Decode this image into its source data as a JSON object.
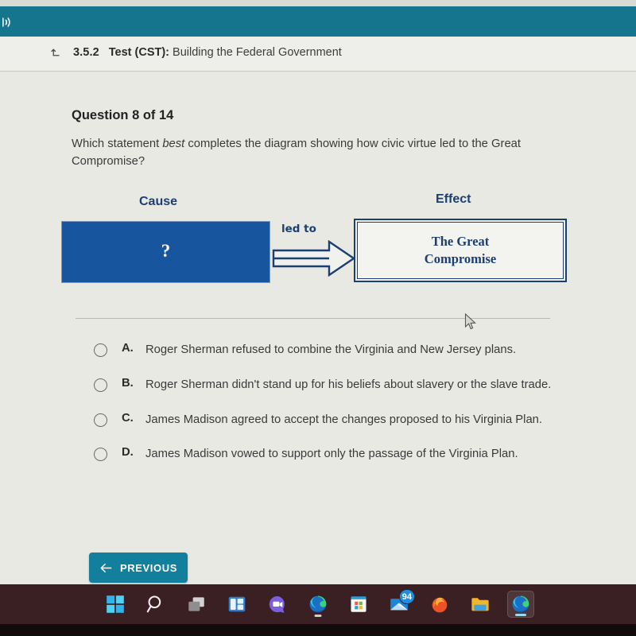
{
  "colors": {
    "teal_bar": "#15758C",
    "page_bg": "#E9E9E4",
    "cause_box_blue": "#17559F",
    "navy_text": "#1C3F72",
    "button_teal": "#12809C",
    "taskbar": "#3B2023",
    "badge_blue": "#1F8EE0"
  },
  "app_bar": {
    "sound_icon": "speaker-volume-icon"
  },
  "breadcrumb": {
    "up_icon": "return-up-arrow-icon",
    "number": "3.5.2",
    "title_bold": "Test (CST):",
    "title_rest": "Building the Federal Government"
  },
  "question": {
    "heading": "Question 8 of 14",
    "prompt_part1": "Which statement ",
    "prompt_emphasis": "best",
    "prompt_part2": " completes the diagram showing how civic virtue led to the Great Compromise?"
  },
  "diagram": {
    "cause_label": "Cause",
    "effect_label": "Effect",
    "cause_box_text": "?",
    "arrow_label": "led to",
    "effect_box_line1": "The Great",
    "effect_box_line2": "Compromise",
    "arrow_icon": "block-arrow-right-icon"
  },
  "choices": [
    {
      "letter": "A.",
      "text": "Roger Sherman refused to combine the Virginia and New Jersey plans.",
      "radio_icon": "radio-unselected-icon",
      "selected": false
    },
    {
      "letter": "B.",
      "text": "Roger Sherman didn't stand up for his beliefs about slavery or the slave trade.",
      "radio_icon": "radio-unselected-icon",
      "selected": false
    },
    {
      "letter": "C.",
      "text": "James Madison agreed to accept the changes proposed to his Virginia Plan.",
      "radio_icon": "radio-unselected-icon",
      "selected": false
    },
    {
      "letter": "D.",
      "text": "James Madison vowed to support only the passage of the Virginia Plan.",
      "radio_icon": "radio-unselected-icon",
      "selected": false
    }
  ],
  "footer": {
    "previous_label": "PREVIOUS",
    "previous_icon": "arrow-left-icon"
  },
  "taskbar": {
    "items": [
      {
        "icon": "windows-start-icon",
        "name": "start"
      },
      {
        "icon": "search-icon",
        "name": "search"
      },
      {
        "icon": "task-view-icon",
        "name": "task-view"
      },
      {
        "icon": "widgets-icon",
        "name": "widgets"
      },
      {
        "icon": "teams-chat-icon",
        "name": "chat"
      },
      {
        "icon": "edge-browser-icon",
        "name": "edge"
      },
      {
        "icon": "microsoft-store-icon",
        "name": "store"
      },
      {
        "icon": "mail-icon",
        "name": "mail",
        "badge": "94"
      },
      {
        "icon": "firefox-icon",
        "name": "firefox"
      },
      {
        "icon": "file-explorer-icon",
        "name": "file-explorer"
      },
      {
        "icon": "edge-browser-icon",
        "name": "edge-active"
      }
    ]
  },
  "cursor": {
    "icon": "mouse-pointer-icon"
  }
}
